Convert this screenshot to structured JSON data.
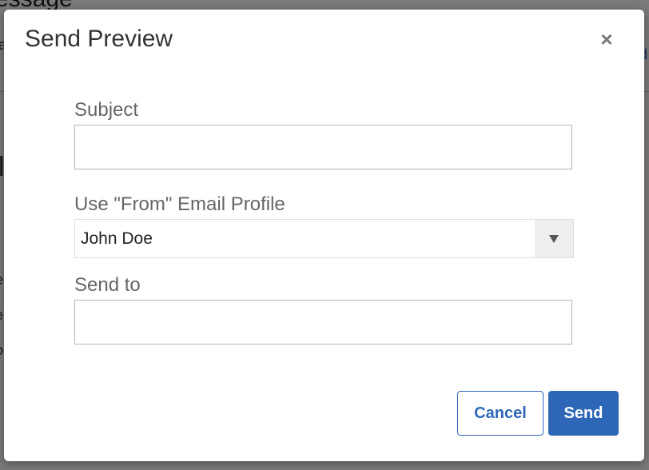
{
  "background": {
    "title_fragment": "essage",
    "fragments": [
      "a",
      "l",
      "e",
      "e",
      "o",
      "d"
    ]
  },
  "modal": {
    "title": "Send Preview",
    "close_symbol": "×",
    "subject": {
      "label": "Subject",
      "value": "",
      "placeholder": ""
    },
    "from_profile": {
      "label": "Use \"From\" Email Profile",
      "selected": "John Doe",
      "arrow_icon": "triangle-down-icon"
    },
    "send_to": {
      "label": "Send to",
      "value": "",
      "placeholder": ""
    },
    "buttons": {
      "cancel": "Cancel",
      "send": "Send"
    }
  },
  "colors": {
    "accent": "#2e67b8",
    "overlay": "#7a7a7a"
  }
}
